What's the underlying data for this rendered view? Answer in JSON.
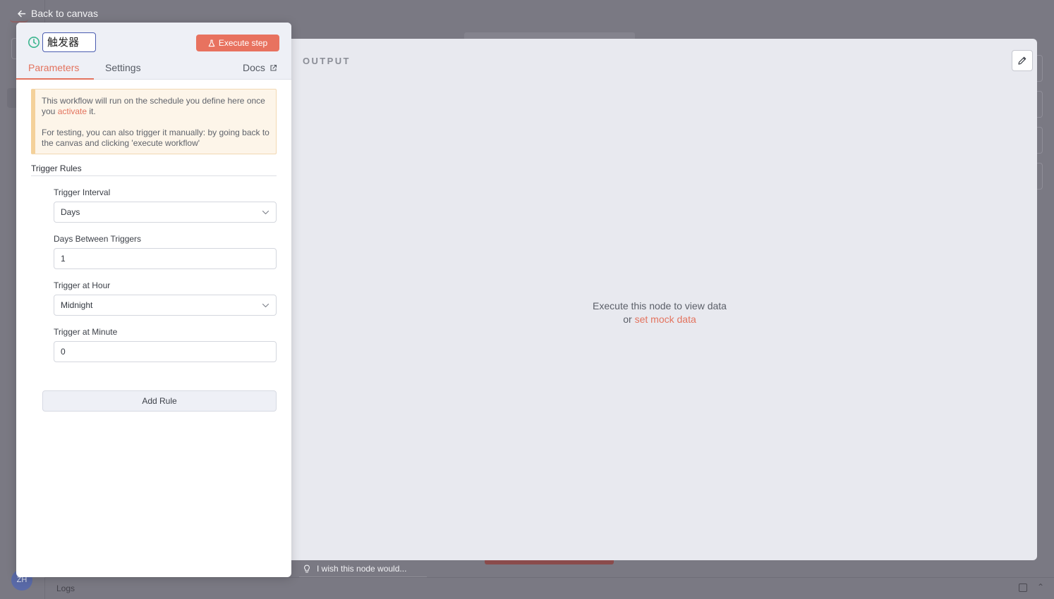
{
  "navigation": {
    "back_label": "Back to canvas"
  },
  "node": {
    "name": "触发器",
    "execute_label": "Execute step"
  },
  "tabs": {
    "parameters": "Parameters",
    "settings": "Settings",
    "docs": "Docs"
  },
  "notice": {
    "line1_before": "This workflow will run on the schedule you define here once you ",
    "line1_link": "activate",
    "line1_after": " it.",
    "line2": "For testing, you can also trigger it manually: by going back to the canvas and clicking 'execute workflow'"
  },
  "trigger_rules": {
    "section_label": "Trigger Rules",
    "fields": {
      "interval_label": "Trigger Interval",
      "interval_value": "Days",
      "days_between_label": "Days Between Triggers",
      "days_between_value": "1",
      "hour_label": "Trigger at Hour",
      "hour_value": "Midnight",
      "minute_label": "Trigger at Minute",
      "minute_value": "0"
    },
    "add_rule_label": "Add Rule"
  },
  "output": {
    "title": "OUTPUT",
    "empty_line1": "Execute this node to view data",
    "empty_or": "or ",
    "empty_link": "set mock data"
  },
  "feedback": {
    "wish_text": "I wish this node would..."
  },
  "footer": {
    "logs_label": "Logs",
    "avatar_text": "ZH"
  },
  "colors": {
    "accent": "#e3735e",
    "execute_button": "#e8725f",
    "notice_border": "#f4d19a",
    "clock_icon": "#3bb58e",
    "focus_border": "#4a5cb0"
  },
  "icons": {
    "back": "arrow-left-icon",
    "node": "clock-icon",
    "execute": "flask-icon",
    "docs": "external-link-icon",
    "edit": "pencil-icon",
    "dropdown": "chevron-down-icon",
    "feedback": "lightbulb-icon"
  }
}
